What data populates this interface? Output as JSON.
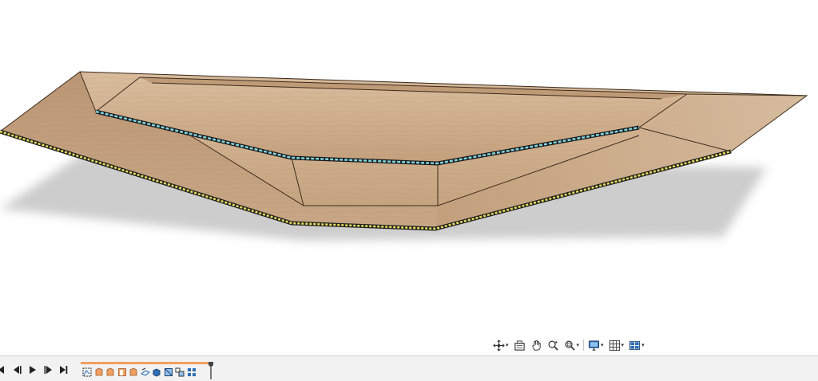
{
  "colors": {
    "background": "#ffffff",
    "wood_light": "#d2b494",
    "wood_mid": "#c09a74",
    "wood_dark": "#a57e59",
    "edge_outer": "#e8e05a",
    "edge_inner": "#7fd6e0",
    "shadow": "#c4c4c4",
    "timeline_accent": "#f0a060"
  },
  "navigation_toolbar": {
    "tools": [
      {
        "icon": "orbit-icon",
        "has_dropdown": true
      },
      {
        "icon": "look-at-icon",
        "has_dropdown": false
      },
      {
        "icon": "pan-hand-icon",
        "has_dropdown": false
      },
      {
        "icon": "zoom-icon",
        "has_dropdown": false
      },
      {
        "icon": "fit-zoom-icon",
        "has_dropdown": true
      },
      {
        "icon": "display-settings-icon",
        "has_dropdown": true
      },
      {
        "icon": "grid-snaps-icon",
        "has_dropdown": true
      },
      {
        "icon": "viewports-icon",
        "has_dropdown": true
      }
    ]
  },
  "timeline": {
    "playback_controls": [
      "go-to-start-icon",
      "step-back-icon",
      "play-icon",
      "step-forward-icon",
      "go-to-end-icon"
    ],
    "features": [
      "sketch-feature-icon",
      "flange-feature-icon",
      "flange-feature-icon",
      "extrude-feature-icon",
      "flange-feature-icon",
      "unfold-feature-icon",
      "body-feature-icon",
      "refold-feature-icon",
      "component-feature-icon",
      "pattern-feature-icon"
    ],
    "progress_fraction": 1.0
  }
}
